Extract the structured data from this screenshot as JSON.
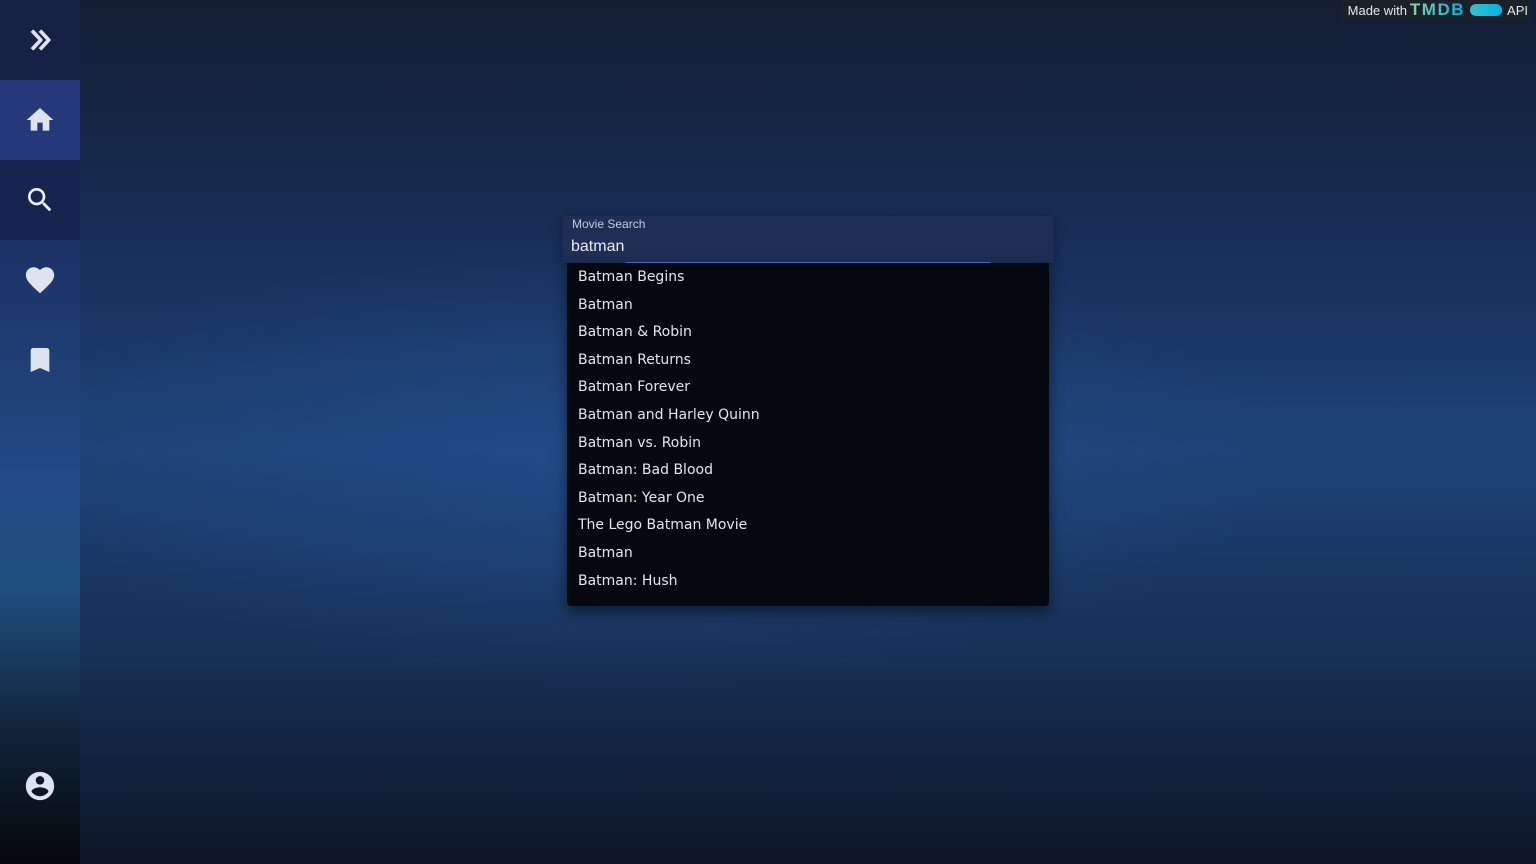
{
  "sidebar": {
    "items": [
      {
        "id": "expand",
        "icon": "double-chevron-right-icon"
      },
      {
        "id": "home",
        "icon": "home-icon"
      },
      {
        "id": "search",
        "icon": "search-icon"
      },
      {
        "id": "favorites",
        "icon": "heart-icon"
      },
      {
        "id": "watchlist",
        "icon": "bookmark-icon"
      },
      {
        "id": "account",
        "icon": "account-circle-icon"
      }
    ]
  },
  "badge": {
    "prefix": "Made with",
    "brand": "TMDB",
    "suffix": "API"
  },
  "search": {
    "label": "Movie Search",
    "value": "batman",
    "results": [
      "Batman Begins",
      "Batman",
      "Batman & Robin",
      "Batman Returns",
      "Batman Forever",
      "Batman and Harley Quinn",
      "Batman vs. Robin",
      "Batman: Bad Blood",
      "Batman: Year One",
      "The Lego Batman Movie",
      "Batman",
      "Batman: Hush"
    ]
  },
  "colors": {
    "accent": "#5575d8",
    "tmdb_green": "#90cea1",
    "tmdb_blue": "#01b4e4",
    "icon": "#dde3ef"
  }
}
